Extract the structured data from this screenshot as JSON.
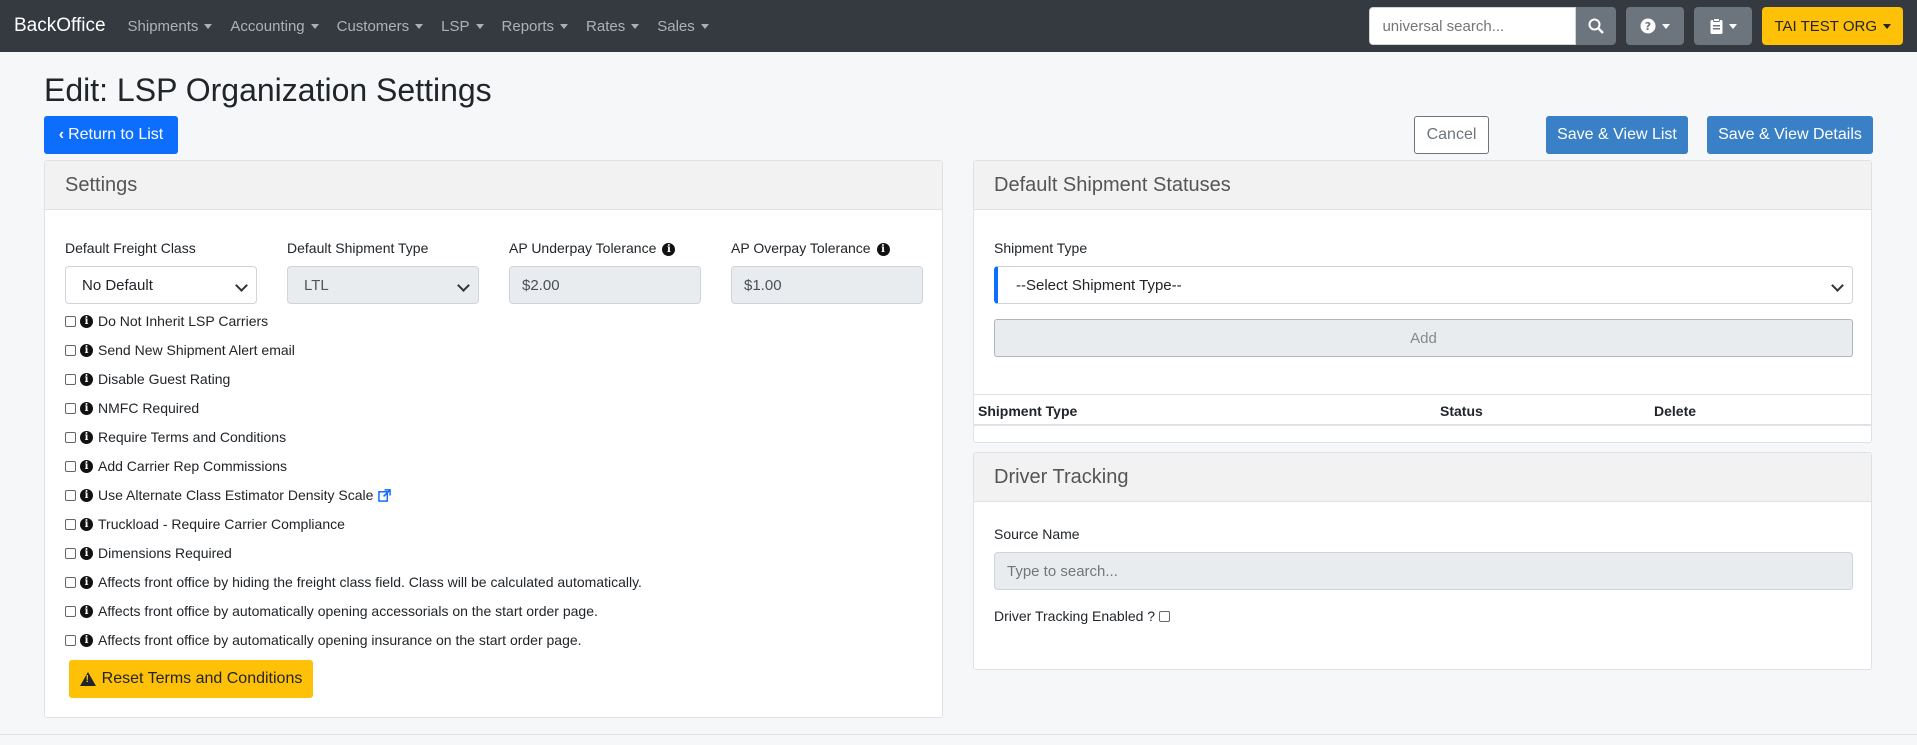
{
  "navbar": {
    "brand": "BackOffice",
    "menu": [
      "Shipments",
      "Accounting",
      "Customers",
      "LSP",
      "Reports",
      "Rates",
      "Sales"
    ],
    "search_placeholder": "universal search...",
    "org_label": "TAI TEST ORG",
    "icons": [
      "search-icon",
      "question-icon",
      "clipboard-icon"
    ]
  },
  "page": {
    "title": "Edit: LSP Organization Settings",
    "return_label": "Return to List",
    "cancel_label": "Cancel",
    "save_list_label": "Save & View List",
    "save_details_label": "Save & View Details"
  },
  "settings": {
    "header": "Settings",
    "freight_class_label": "Default Freight Class",
    "freight_class_value": "No Default",
    "shipment_type_label": "Default Shipment Type",
    "shipment_type_value": "LTL",
    "underpay_label": "AP Underpay Tolerance",
    "underpay_value": "$2.00",
    "overpay_label": "AP Overpay Tolerance",
    "overpay_value": "$1.00",
    "checkboxes": [
      "Do Not Inherit LSP Carriers",
      "Send New Shipment Alert email",
      "Disable Guest Rating",
      "NMFC Required",
      "Require Terms and Conditions",
      "Add Carrier Rep Commissions",
      "Use Alternate Class Estimator Density Scale",
      "Truckload - Require Carrier Compliance",
      "Dimensions Required",
      "Affects front office by hiding the freight class field. Class will be calculated automatically.",
      "Affects front office by automatically opening accessorials on the start order page.",
      "Affects front office by automatically opening insurance on the start order page."
    ],
    "reset_label": "Reset Terms and Conditions"
  },
  "statuses": {
    "header": "Default Shipment Statuses",
    "shipment_type_label": "Shipment Type",
    "shipment_type_placeholder": "--Select Shipment Type--",
    "add_label": "Add",
    "columns": [
      "Shipment Type",
      "Status",
      "Delete"
    ]
  },
  "driver": {
    "header": "Driver Tracking",
    "source_label": "Source Name",
    "source_placeholder": "Type to search...",
    "enabled_label": "Driver Tracking Enabled ?"
  },
  "colors": {
    "navbar": "#343a40",
    "primary": "#0d6efd",
    "save": "#3a80c6",
    "warning": "#ffc107"
  }
}
